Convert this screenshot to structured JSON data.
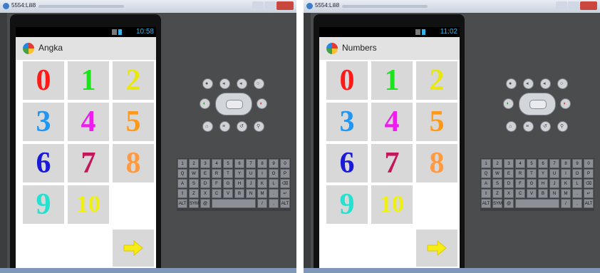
{
  "screens": [
    {
      "window_title": "5554:Lili8",
      "time": "10:58",
      "app_title": "Angka"
    },
    {
      "window_title": "5554:Lili8",
      "time": "11:02",
      "app_title": "Numbers"
    }
  ],
  "number_tiles": [
    {
      "label": "0",
      "color": "#ff1a1a"
    },
    {
      "label": "1",
      "color": "#1de21d"
    },
    {
      "label": "2",
      "color": "#e8e810"
    },
    {
      "label": "3",
      "color": "#2196f3"
    },
    {
      "label": "4",
      "color": "#ee1cee"
    },
    {
      "label": "5",
      "color": "#ff9a18"
    },
    {
      "label": "6",
      "color": "#1a1ad8"
    },
    {
      "label": "7",
      "color": "#c2185b"
    },
    {
      "label": "8",
      "color": "#ff9a40"
    },
    {
      "label": "9",
      "color": "#26e0d0"
    },
    {
      "label": "10",
      "color": "#f0f010"
    }
  ],
  "next_button": {
    "icon": "arrow-right-icon",
    "color": "#f6ec18"
  },
  "emulator_controls": {
    "buttons": [
      "camera-icon",
      "volume-down-icon",
      "volume-up-icon",
      "power-icon",
      "call-icon",
      "end-call-icon",
      "home-icon",
      "menu-icon",
      "back-icon",
      "search-icon"
    ]
  },
  "keyboard": {
    "rows": [
      [
        "1",
        "2",
        "3",
        "4",
        "5",
        "6",
        "7",
        "8",
        "9",
        "0"
      ],
      [
        "Q",
        "W",
        "E",
        "R",
        "T",
        "Y",
        "U",
        "I",
        "O",
        "P"
      ],
      [
        "A",
        "S",
        "D",
        "F",
        "G",
        "H",
        "J",
        "K",
        "L",
        "⌫"
      ],
      [
        "⇧",
        "Z",
        "X",
        "C",
        "V",
        "B",
        "N",
        "M",
        ".",
        "↵"
      ],
      [
        "ALT",
        "SYM",
        "@",
        "",
        "",
        "",
        "",
        "/",
        ",",
        "ALT"
      ]
    ]
  }
}
